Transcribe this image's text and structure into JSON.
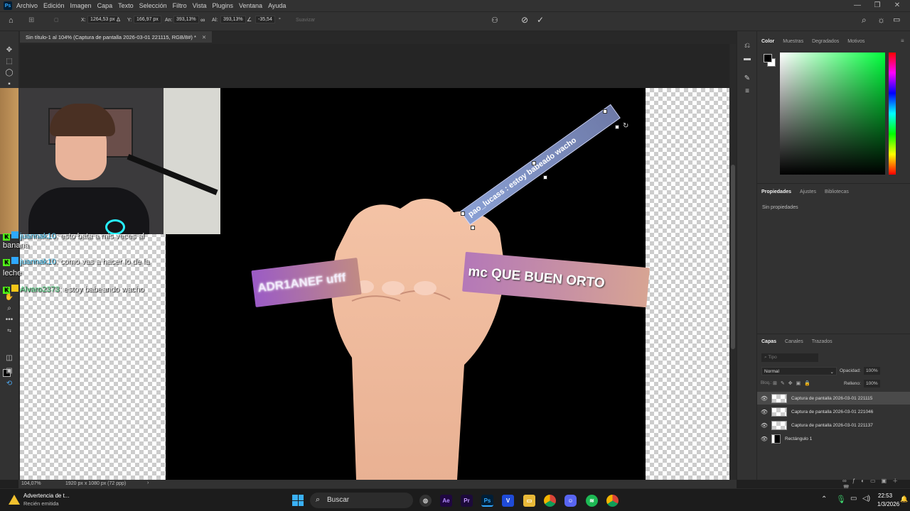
{
  "menubar": {
    "app_badge": "Ps",
    "items": [
      "Archivo",
      "Edición",
      "Imagen",
      "Capa",
      "Texto",
      "Selección",
      "Filtro",
      "Vista",
      "Plugins",
      "Ventana",
      "Ayuda"
    ]
  },
  "options": {
    "x_label": "X:",
    "x_value": "1264,53 px",
    "y_label": "Y:",
    "y_value": "166,97 px",
    "w_label": "An:",
    "w_value": "393,13%",
    "h_label": "Al:",
    "h_value": "393,13%",
    "angle_value": "-35,54",
    "interp_label": "Suavizar"
  },
  "document": {
    "tab_title": "Sin título-1 al 104% (Captura de pantalla 2026-03-01 221115, RGB/8#) *",
    "zoom": "104,07%",
    "doc_info": "1920 px x 1080 px (72 ppp)"
  },
  "chat": {
    "line1_user": "juannak10",
    "line1_text": ": esto bata a mis veces al",
    "line1_wrap": "banana",
    "line2_user": "juannak10",
    "line2_text": ": como vas a hacer lo de la",
    "line2_wrap": "leche",
    "line3_user": "Alvaro2373",
    "line3_text": ": estoy babeando wacho"
  },
  "canvas_strips": {
    "strip_left": "ADR1ANEF ufff",
    "strip_right": "mc  QUE BUEN ORTO",
    "strip_diagonal": "pao_lucass : estoy babeado wacho"
  },
  "panels": {
    "color_tabs": [
      "Color",
      "Muestras",
      "Degradados",
      "Motivos"
    ],
    "props_tabs": [
      "Propiedades",
      "Ajustes",
      "Bibliotecas"
    ],
    "props_empty": "Sin propiedades",
    "layers_tabs": [
      "Capas",
      "Canales",
      "Trazados"
    ],
    "search_placeholder": "Tipo",
    "blend_mode": "Normal",
    "opacity_label": "Opacidad:",
    "opacity_value": "100%",
    "lock_label": "Bloq.:",
    "fill_label": "Relleno:",
    "fill_value": "100%",
    "layers": [
      {
        "name": "Captura de pantalla 2026-03-01 221115",
        "selected": true
      },
      {
        "name": "Captura de pantalla 2026-03-01 221046",
        "selected": false
      },
      {
        "name": "Captura de pantalla 2026-03-01 221137",
        "selected": false
      },
      {
        "name": "Rectángulo 1",
        "selected": false
      }
    ]
  },
  "taskbar": {
    "notification_title": "Advertencia de t...",
    "notification_sub": "Recién emitida",
    "search_label": "Buscar",
    "time": "22:53",
    "date": "1/3/2026",
    "app_icons": [
      "Ae",
      "Pr",
      "Ps",
      "V"
    ]
  },
  "colors": {
    "accent": "#31a8ff",
    "panel_bg": "#323232",
    "canvas_black": "#000000"
  }
}
